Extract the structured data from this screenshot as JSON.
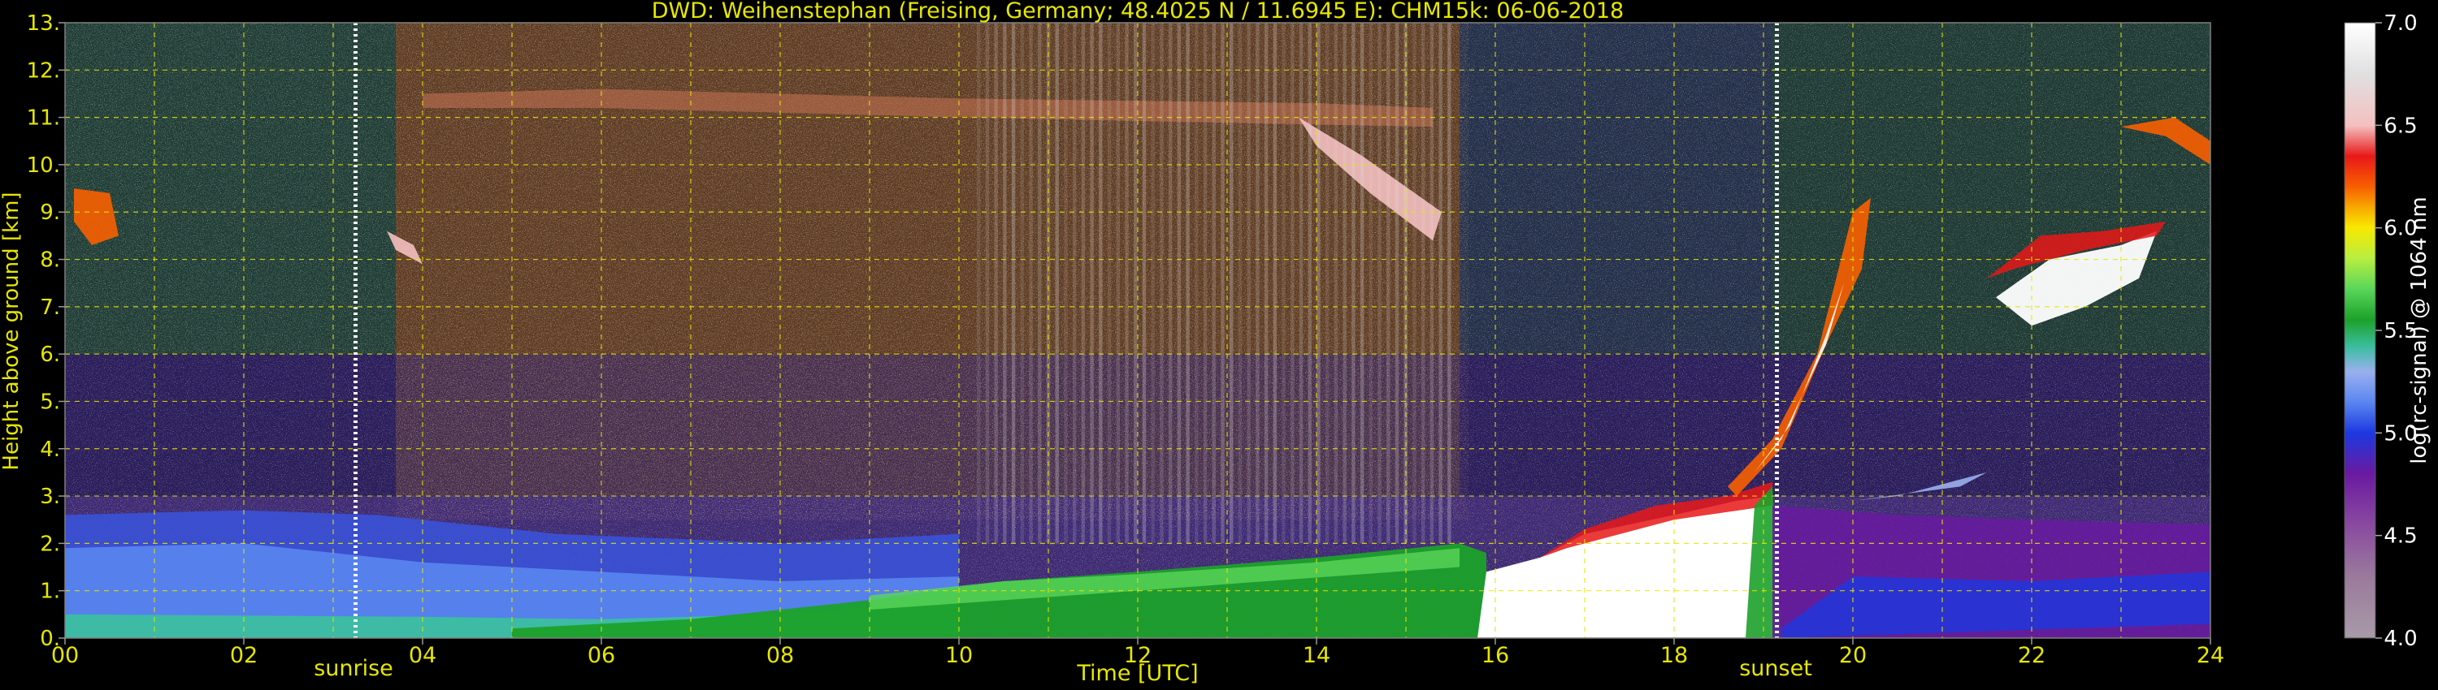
{
  "chart_data": {
    "type": "heatmap",
    "title": "DWD: Weihenstephan (Freising, Germany; 48.4025 N / 11.6945 E):    CHM15k: 06-06-2018",
    "xlabel": "Time [UTC]",
    "ylabel": "Height above ground [km]",
    "colorbar_label": "log(rc-signal) @ 1064 nm",
    "xlim": [
      0,
      24
    ],
    "ylim": [
      0,
      13
    ],
    "x_ticks": [
      "00",
      "02",
      "04",
      "06",
      "08",
      "10",
      "12",
      "14",
      "16",
      "18",
      "20",
      "22",
      "24"
    ],
    "y_ticks": [
      "0.",
      "1.",
      "2.",
      "3.",
      "4.",
      "5.",
      "6.",
      "7.",
      "8.",
      "9.",
      "10.",
      "11.",
      "12.",
      "13."
    ],
    "colorbar_range": [
      4.0,
      7.0
    ],
    "colorbar_ticks": [
      "4.0",
      "4.5",
      "5.0",
      "5.5",
      "6.0",
      "6.5",
      "7.0"
    ],
    "grid": true,
    "grid_color": "#e6e600",
    "text_color": "#e6e600",
    "annotations": [
      {
        "label": "sunrise",
        "time_utc": 3.25
      },
      {
        "label": "sunset",
        "time_utc": 19.15
      }
    ],
    "colormap": [
      {
        "v": 4.0,
        "c": "#a89aa8"
      },
      {
        "v": 4.3,
        "c": "#9a7a9c"
      },
      {
        "v": 4.55,
        "c": "#8a4aa0"
      },
      {
        "v": 4.8,
        "c": "#6a1aa0"
      },
      {
        "v": 5.0,
        "c": "#1c38e0"
      },
      {
        "v": 5.15,
        "c": "#5a86f0"
      },
      {
        "v": 5.3,
        "c": "#9ab0ee"
      },
      {
        "v": 5.42,
        "c": "#3cbea0"
      },
      {
        "v": 5.55,
        "c": "#1ca12a"
      },
      {
        "v": 5.7,
        "c": "#5ad65a"
      },
      {
        "v": 5.85,
        "c": "#b8ee40"
      },
      {
        "v": 6.0,
        "c": "#f8e800"
      },
      {
        "v": 6.1,
        "c": "#f8a800"
      },
      {
        "v": 6.2,
        "c": "#f86000"
      },
      {
        "v": 6.35,
        "c": "#e81818"
      },
      {
        "v": 6.5,
        "c": "#f4c0c0"
      },
      {
        "v": 6.75,
        "c": "#e0e0e0"
      },
      {
        "v": 7.0,
        "c": "#ffffff"
      }
    ]
  }
}
